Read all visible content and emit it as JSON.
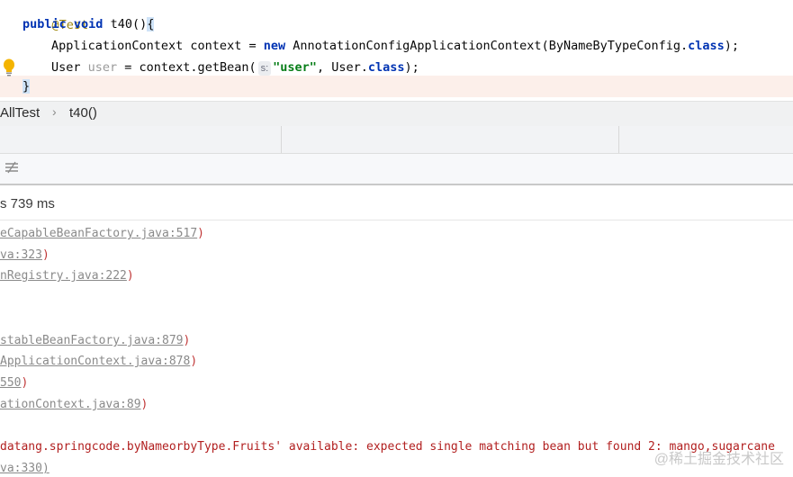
{
  "editor": {
    "lines": {
      "annotation": "@Test",
      "kw_public": "public",
      "kw_void": "void",
      "method_sig": " t40()",
      "open_brace": "{",
      "line3_a": "ApplicationContext context = ",
      "kw_new": "new",
      "line3_b": " AnnotationConfigApplicationContext(ByNameByTypeConfig.",
      "kw_class1": "class",
      "line3_c": ");",
      "line4_a": "User ",
      "line4_var": "user",
      "line4_b": " = context.getBean(",
      "hint_s": "s:",
      "line4_str": "\"user\"",
      "line4_c": ", User.",
      "kw_class2": "class",
      "line4_d": ");",
      "close_brace": "}"
    }
  },
  "breadcrumb": {
    "class_name": "AllTest",
    "separator": "›",
    "method_name": "t40()"
  },
  "run": {
    "duration": "s 739 ms"
  },
  "console": {
    "lines": [
      {
        "link": "eCapableBeanFactory.java:517",
        "suffix": ")"
      },
      {
        "link": "va:323",
        "suffix": ")"
      },
      {
        "link": "nRegistry.java:222",
        "suffix": ")"
      },
      {
        "link": "stableBeanFactory.java:879",
        "suffix": ")"
      },
      {
        "link": "ApplicationContext.java:878",
        "suffix": ")"
      },
      {
        "link": "550",
        "suffix": ")"
      },
      {
        "link": "ationContext.java:89",
        "suffix": ")"
      }
    ],
    "error_line": "datang.springcode.byNameorbyType.Fruits' available: expected single matching bean but found 2: mango,sugarcane",
    "last_line": "va:330)"
  },
  "watermark": "@稀土掘金技术社区",
  "colors": {
    "keyword": "#0033b3",
    "string": "#067d17",
    "error_text": "#b22020",
    "current_line": "#fcefea"
  },
  "icons": {
    "bulb": "lightbulb-icon",
    "filter": "filter-icon",
    "chevron": "chevron-right-icon"
  }
}
